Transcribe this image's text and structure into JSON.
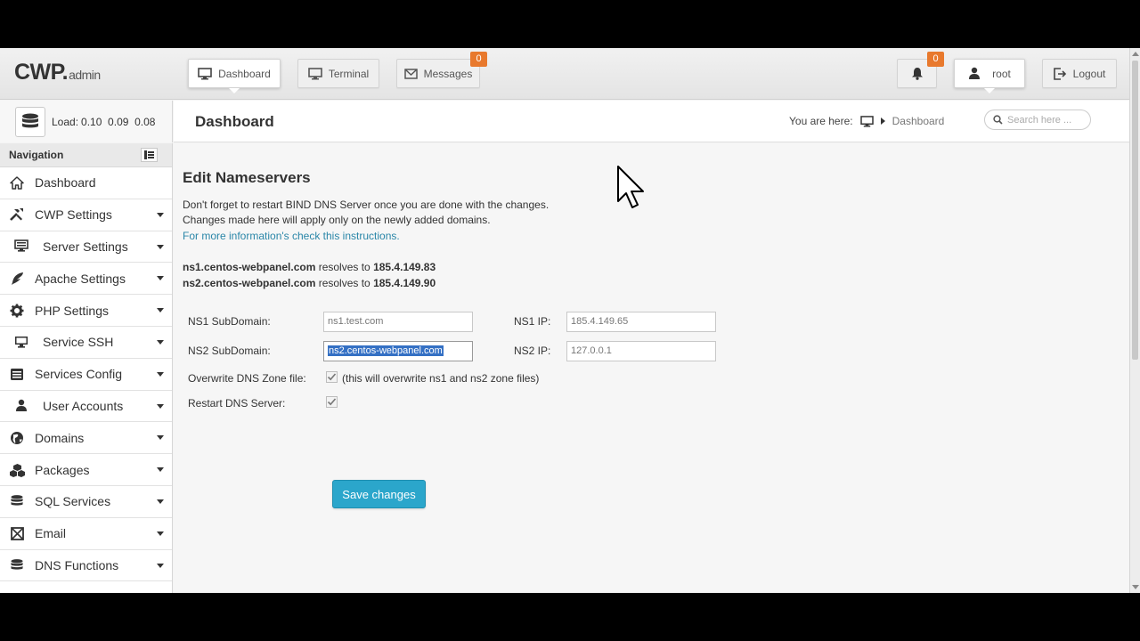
{
  "app": {
    "logo": "CWP.",
    "logo_sub": "admin"
  },
  "topbar": {
    "dashboard": "Dashboard",
    "terminal": "Terminal",
    "messages": "Messages",
    "messages_count": "0",
    "alerts_count": "0",
    "user": "root",
    "logout": "Logout"
  },
  "status": {
    "load_label": "Load:",
    "load_values": "0.10  0.09  0.08"
  },
  "header": {
    "page_title": "Dashboard",
    "breadcrumb_prefix": "You are here:",
    "breadcrumb_current": "Dashboard",
    "search_placeholder": "Search here ..."
  },
  "sidebar": {
    "title": "Navigation",
    "items": [
      {
        "label": "Dashboard",
        "icon": "home-icon"
      },
      {
        "label": "CWP Settings",
        "icon": "tools-icon"
      },
      {
        "label": "Server Settings",
        "icon": "server-icon"
      },
      {
        "label": "Apache Settings",
        "icon": "feather-icon"
      },
      {
        "label": "PHP Settings",
        "icon": "gear-icon"
      },
      {
        "label": "Service SSH",
        "icon": "monitor-icon"
      },
      {
        "label": "Services Config",
        "icon": "list-icon"
      },
      {
        "label": "User Accounts",
        "icon": "user-icon"
      },
      {
        "label": "Domains",
        "icon": "globe-icon"
      },
      {
        "label": "Packages",
        "icon": "cubes-icon"
      },
      {
        "label": "SQL Services",
        "icon": "database-icon"
      },
      {
        "label": "Email",
        "icon": "email-icon"
      },
      {
        "label": "DNS Functions",
        "icon": "dns-icon"
      }
    ]
  },
  "main": {
    "heading": "Edit Nameservers",
    "note1": "Don't forget to restart BIND DNS Server once you are done with the changes.",
    "note2": "Changes made here will apply only on the newly added domains.",
    "note_link": "For more information's check this instructions.",
    "ns1": {
      "host": "ns1.centos-webpanel.com",
      "mid": " resolves to ",
      "ip": "185.4.149.83"
    },
    "ns2": {
      "host": "ns2.centos-webpanel.com",
      "mid": " resolves to ",
      "ip": "185.4.149.90"
    },
    "form": {
      "ns1_sub_label": "NS1 SubDomain:",
      "ns1_sub_value": "ns1.test.com",
      "ns1_ip_label": "NS1 IP:",
      "ns1_ip_value": "185.4.149.65",
      "ns2_sub_label": "NS2 SubDomain:",
      "ns2_sub_value": "ns2.centos-webpanel.com",
      "ns2_ip_label": "NS2 IP:",
      "ns2_ip_value": "127.0.0.1",
      "overwrite_label": "Overwrite DNS Zone file:",
      "overwrite_checked": true,
      "overwrite_hint": "(this will overwrite ns1 and ns2 zone files)",
      "restart_label": "Restart DNS Server:",
      "restart_checked": true,
      "save_label": "Save changes"
    }
  },
  "colors": {
    "accent": "#2ba6cb",
    "badge": "#e8792d",
    "link": "#2a86a8",
    "selection": "#3470c4"
  }
}
